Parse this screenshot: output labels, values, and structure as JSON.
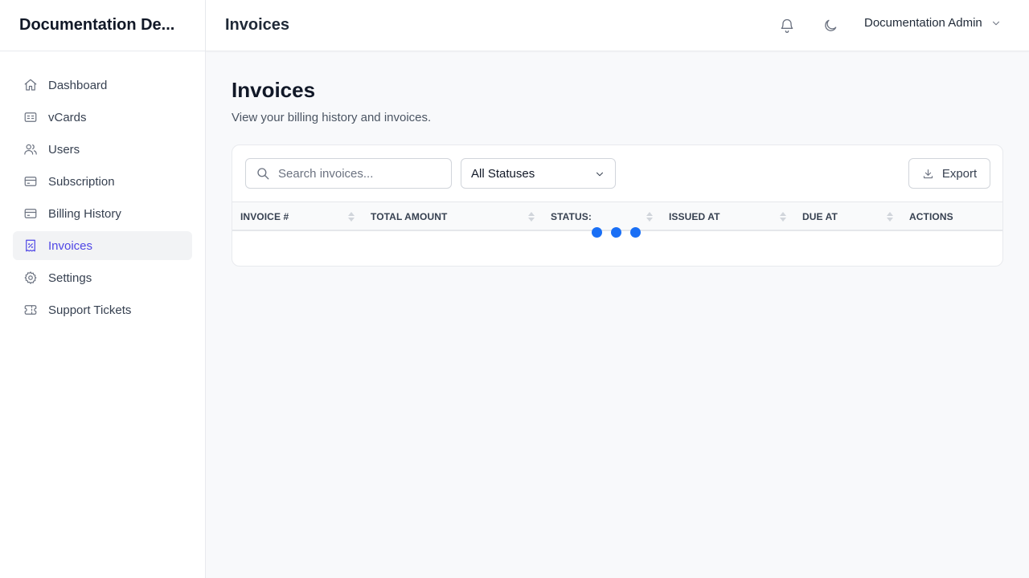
{
  "app": {
    "brand": "Documentation De..."
  },
  "sidebar": {
    "items": [
      {
        "label": "Dashboard",
        "icon": "home-icon",
        "active": false
      },
      {
        "label": "vCards",
        "icon": "id-card-icon",
        "active": false
      },
      {
        "label": "Users",
        "icon": "users-icon",
        "active": false
      },
      {
        "label": "Subscription",
        "icon": "credit-card-icon",
        "active": false
      },
      {
        "label": "Billing History",
        "icon": "credit-card-icon",
        "active": false
      },
      {
        "label": "Invoices",
        "icon": "receipt-percent-icon",
        "active": true
      },
      {
        "label": "Settings",
        "icon": "gear-icon",
        "active": false
      },
      {
        "label": "Support Tickets",
        "icon": "ticket-icon",
        "active": false
      }
    ]
  },
  "header": {
    "title": "Invoices",
    "user_name": "Documentation Admin"
  },
  "page": {
    "title": "Invoices",
    "subtitle": "View your billing history and invoices."
  },
  "toolbar": {
    "search_placeholder": "Search invoices...",
    "status_filter": "All Statuses",
    "export_label": "Export"
  },
  "table": {
    "columns": [
      "INVOICE #",
      "TOTAL AMOUNT",
      "STATUS:",
      "ISSUED AT",
      "DUE AT",
      "ACTIONS"
    ],
    "rows": [],
    "loading": true
  },
  "colors": {
    "accent": "#4f46e5",
    "loader": "#1a6ff5"
  }
}
